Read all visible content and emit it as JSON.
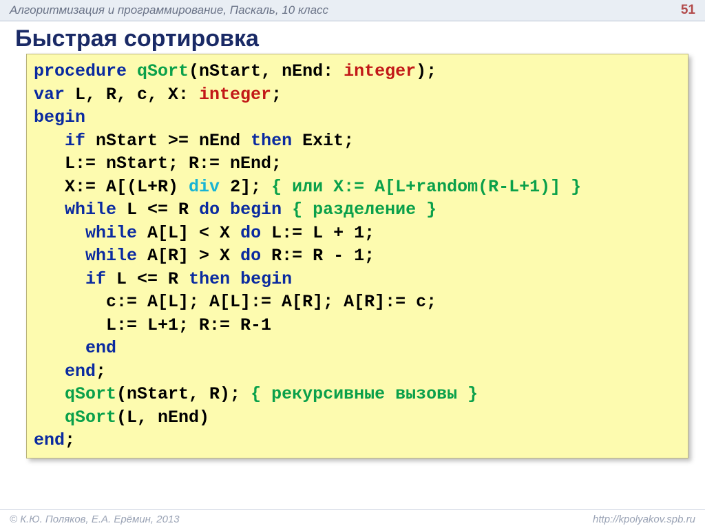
{
  "header": {
    "breadcrumb": "Алгоритмизация и программирование, Паскаль, 10 класс",
    "page_number": "51"
  },
  "title": "Быстрая сортировка",
  "code": {
    "tokens": [
      [
        {
          "t": "procedure ",
          "c": "kw"
        },
        {
          "t": "qSort",
          "c": "fn"
        },
        {
          "t": "(nStart, nEnd: "
        },
        {
          "t": "integer",
          "c": "ty"
        },
        {
          "t": ");"
        }
      ],
      [
        {
          "t": "var ",
          "c": "kw"
        },
        {
          "t": "L, R, c, X: "
        },
        {
          "t": "integer",
          "c": "ty"
        },
        {
          "t": ";"
        }
      ],
      [
        {
          "t": "begin",
          "c": "kw"
        }
      ],
      [
        {
          "t": "   "
        },
        {
          "t": "if ",
          "c": "kw"
        },
        {
          "t": "nStart >= nEnd "
        },
        {
          "t": "then ",
          "c": "kw"
        },
        {
          "t": "Exit;"
        }
      ],
      [
        {
          "t": "   L:= nStart; R:= nEnd;"
        }
      ],
      [
        {
          "t": "   X:= A[(L+R) "
        },
        {
          "t": "div",
          "c": "op"
        },
        {
          "t": " 2]; "
        },
        {
          "t": "{ или X:= A[L+random(R-L+1)] }",
          "c": "cm"
        }
      ],
      [
        {
          "t": "   "
        },
        {
          "t": "while ",
          "c": "kw"
        },
        {
          "t": "L <= R "
        },
        {
          "t": "do begin ",
          "c": "kw"
        },
        {
          "t": "{ разделение }",
          "c": "cm"
        }
      ],
      [
        {
          "t": "     "
        },
        {
          "t": "while ",
          "c": "kw"
        },
        {
          "t": "A[L] < X "
        },
        {
          "t": "do ",
          "c": "kw"
        },
        {
          "t": "L:= L + 1;"
        }
      ],
      [
        {
          "t": "     "
        },
        {
          "t": "while ",
          "c": "kw"
        },
        {
          "t": "A[R] > X "
        },
        {
          "t": "do ",
          "c": "kw"
        },
        {
          "t": "R:= R - 1;"
        }
      ],
      [
        {
          "t": "     "
        },
        {
          "t": "if ",
          "c": "kw"
        },
        {
          "t": "L <= R "
        },
        {
          "t": "then begin",
          "c": "kw"
        }
      ],
      [
        {
          "t": "       c:= A[L]; A[L]:= A[R]; A[R]:= c;"
        }
      ],
      [
        {
          "t": "       L:= L+1; R:= R-1"
        }
      ],
      [
        {
          "t": "     "
        },
        {
          "t": "end",
          "c": "kw"
        }
      ],
      [
        {
          "t": "   "
        },
        {
          "t": "end",
          "c": "kw"
        },
        {
          "t": ";"
        }
      ],
      [
        {
          "t": "   "
        },
        {
          "t": "qSort",
          "c": "fn"
        },
        {
          "t": "(nStart, R); "
        },
        {
          "t": "{ рекурсивные вызовы }",
          "c": "cm"
        }
      ],
      [
        {
          "t": "   "
        },
        {
          "t": "qSort",
          "c": "fn"
        },
        {
          "t": "(L, nEnd)"
        }
      ],
      [
        {
          "t": "end",
          "c": "kw"
        },
        {
          "t": ";"
        }
      ]
    ]
  },
  "footer": {
    "copyright": "© К.Ю. Поляков, Е.А. Ерёмин, 2013",
    "url": "http://kpolyakov.spb.ru"
  }
}
